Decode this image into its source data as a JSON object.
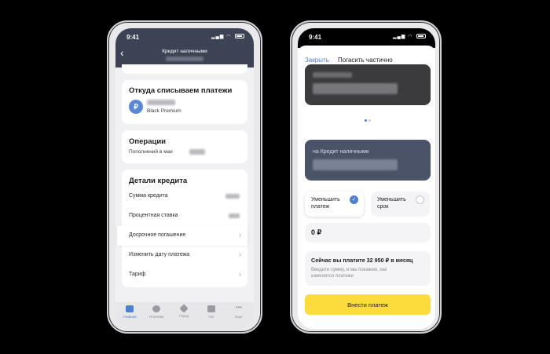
{
  "colors": {
    "background": "#000000",
    "header_dark": "#3c4354",
    "accent_blue": "#4f7fd0",
    "button_yellow": "#fcdc3c",
    "card_dark": "#3b3b3d",
    "card_slate": "#4a5367"
  },
  "left_phone": {
    "status_time": "9:41",
    "header": {
      "title": "Кредит наличными",
      "back_icon": "chevron-left-icon"
    },
    "source_card": {
      "heading": "Откуда списываем платежи",
      "card_name": "Black Premium",
      "icon": "ruble-icon",
      "icon_glyph": "₽"
    },
    "operations_card": {
      "heading": "Операции",
      "subtitle": "Пополнений в мае"
    },
    "details_card": {
      "heading": "Детали кредита",
      "rows": [
        {
          "label": "Сумма кредита"
        },
        {
          "label": "Процентная ставка"
        },
        {
          "label": "Досрочное погашение",
          "chevron": "›"
        },
        {
          "label": "Изменить дату платежа",
          "chevron": "›"
        },
        {
          "label": "Тариф",
          "chevron": "›"
        }
      ]
    },
    "tabbar": [
      {
        "label": "Главная",
        "icon": "home-icon",
        "active": true
      },
      {
        "label": "Платежи",
        "icon": "payments-icon",
        "active": false
      },
      {
        "label": "Город",
        "icon": "city-icon",
        "active": false
      },
      {
        "label": "Чат",
        "icon": "chat-icon",
        "active": false
      },
      {
        "label": "Еще",
        "icon": "more-icon",
        "active": false
      }
    ]
  },
  "right_phone": {
    "status_time": "9:41",
    "close_label": "Закрыть",
    "title": "Погасить частично",
    "slate_card_label": "на Кредит наличными",
    "carousel_page": 1,
    "carousel_total": 2,
    "options": [
      {
        "label": "Уменьшить платеж",
        "selected": true,
        "check_glyph": "✓"
      },
      {
        "label": "Уменьшить срок",
        "selected": false
      }
    ],
    "amount_value": "0 ₽",
    "info": {
      "title": "Сейчас вы платите 32 950 ₽ в месяц",
      "hint": "Введите сумму, и мы покажем, как изменятся платежи"
    },
    "submit_label": "Внести платеж"
  }
}
